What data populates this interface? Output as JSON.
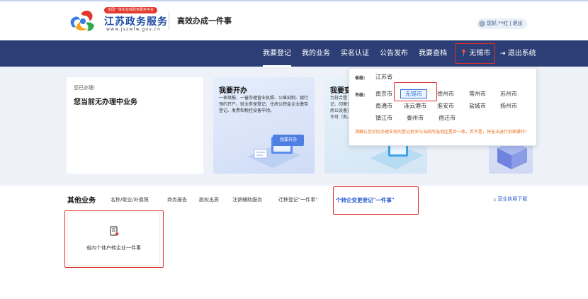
{
  "header": {
    "badge": "全国一体化在线政务服务平台",
    "site_name": "江苏政务服务",
    "site_url": "www.jszwfw.gov.cn",
    "slogan": "高效办成一件事",
    "user_text": "您好,**红",
    "logout": "退出"
  },
  "nav": {
    "items": [
      "我要登记",
      "我的业务",
      "实名认证",
      "公告发布",
      "我要查档"
    ],
    "active": "我要登记",
    "city": "无锡市",
    "exit": "退出系统"
  },
  "status_card": {
    "label": "您已办理:",
    "value": "您当前无办理中业务"
  },
  "open_card": {
    "title": "我要开办",
    "desc": "一表填报、一窗办理营业执照、公章刻制、银行预约开户、就业参保登记、住房公积金企业缴存登记、发票和税控设备申领。",
    "badge": "我要开办"
  },
  "change_card": {
    "title": "我要变",
    "desc": "为符合登记、印章住房公设备变许可（务。"
  },
  "dropdown": {
    "province_label": "省级:",
    "province": "江苏省",
    "city_label": "市级:",
    "cities": [
      "南京市",
      "无锡市",
      "徐州市",
      "常州市",
      "苏州市",
      "南通市",
      "连云港市",
      "淮安市",
      "盐城市",
      "扬州市",
      "镇江市",
      "泰州市",
      "宿迁市"
    ],
    "selected": "无锡市",
    "note": "请确认您实际办理业务的登记机关与当前所选地区是否一致，若不是，将无法进行后续操作!"
  },
  "other": {
    "title": "其他业务",
    "tabs": [
      "名称/歇业/补换照",
      "商务报告",
      "股权出质",
      "注销辅助服务",
      "迁移登记\"一件事\"",
      "个转企变更登记\"一件事\""
    ],
    "active_tab": "个转企变更登记\"一件事\"",
    "download": "营业执照下载",
    "card_label": "省内个体户转企业一件事"
  },
  "colors": {
    "nav_bg": "#2c3e75",
    "accent": "#2d5fcf",
    "warning": "#e76f1d",
    "highlight": "#e03030"
  }
}
